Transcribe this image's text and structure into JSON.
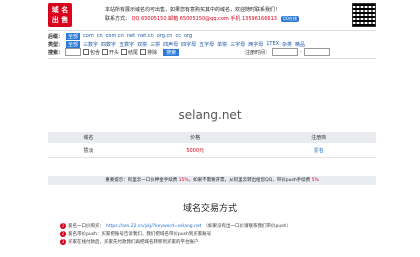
{
  "logo": {
    "line1": "域 名",
    "line2": "出 售"
  },
  "header": {
    "notice": "本站所有展示域名均可出售，如果您有意购买其中的域名，欢迎随时联系我们！",
    "contact_label": "联系方式：",
    "qq_text": "QQ 65005150",
    "mail_text": "邮箱 65005150@qq.com",
    "phone_text": "手机 13596166613",
    "qq_button": "QQ在线"
  },
  "filter": {
    "suffix_label": "后缀：",
    "suffixes": [
      "全部",
      "com",
      "cn",
      "com.cn",
      "net",
      "net.cn",
      "org.cn",
      "cc",
      "org"
    ],
    "type_label": "类型：",
    "types": [
      "全部",
      "三数字",
      "四数字",
      "五数字",
      "双拼",
      "三拼",
      "四声母",
      "四字母",
      "五字母",
      "单拼",
      "三字母",
      "两字母",
      "1TEX",
      "杂类",
      "精品"
    ],
    "types2": [
      "全部",
      "三数字",
      "四数字",
      "五数字",
      "二字母",
      "三字母",
      "四字母",
      "五字母",
      "双拼",
      "三拼",
      "字母单词",
      "字母单词",
      "三数字",
      "四字母",
      "四声母",
      "杂类",
      "三杂",
      "其它"
    ],
    "search_label": "搜索：",
    "options": [
      "包含",
      "开头",
      "结尾",
      "排除"
    ],
    "search_button": "搜索",
    "date_label": "注册时间："
  },
  "domain": "selang.net",
  "table": {
    "headers": [
      "域名",
      "价格",
      "注册商"
    ],
    "row": {
      "name": "慧淡",
      "price": "5000元",
      "registrar": "爱名"
    }
  },
  "tip": {
    "prefix": "重要提示：阿里云一口价押金手续费 ",
    "fee1": "15%",
    "middle": "，如果不需要开票，从阿里云转出给您QQ，带价push手续费 ",
    "fee2": "5%"
  },
  "trade": {
    "title": "域名交易方式",
    "steps": [
      {
        "n": "1",
        "text": "爱名一口价购买：",
        "link": "https://am.22.cn/ykj/?keyword=selang.net",
        "tail": "（如果没有出一口价请联系我们带价push）"
      },
      {
        "n": "2",
        "text": "爱名带价push：买家把账号告诉我们，我们把域名带价push到买家账号",
        "link": "",
        "tail": ""
      },
      {
        "n": "3",
        "text": "买家在线付款后，买家先付款我们再把域名转移到买家的平台账户",
        "link": "",
        "tail": ""
      }
    ]
  },
  "colors": {
    "accent": "#d9001b",
    "link": "#1e6fd6"
  }
}
